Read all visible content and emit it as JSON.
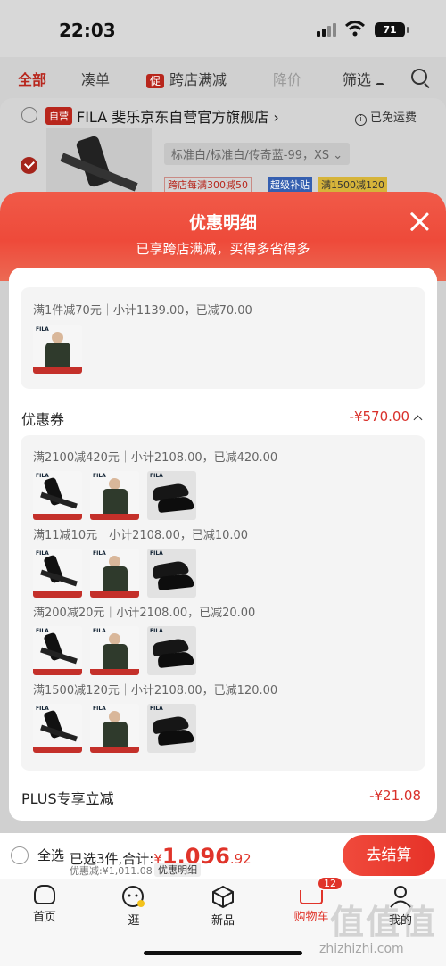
{
  "status_bar": {
    "time": "22:03",
    "battery": "71"
  },
  "background_page": {
    "tabs": {
      "all": "全部",
      "combo": "凑单",
      "promo_badge": "促",
      "cross_store": "跨店满减",
      "price_drop": "降价",
      "filter": "筛选"
    },
    "shop": {
      "self_badge": "自营",
      "name": "FILA 斐乐京东自营官方旗舰店 ›",
      "free_shipping": "已免运费"
    },
    "product": {
      "spec": "标准白/标准白/传奇蓝-99，XS ⌄",
      "tag_cross": "跨店每满300减50",
      "tag_subsidy": "超级补贴",
      "tag_coupon": "满1500减120"
    }
  },
  "sheet": {
    "title": "优惠明细",
    "subtitle": "已享跨店满减，买得多省得多",
    "promo_line": "满1件减70元｜小计1139.00，已减70.00",
    "coupon_section": {
      "label": "优惠券",
      "amount": "-¥570.00"
    },
    "coupon_lines": [
      "满2100减420元｜小计2108.00，已减420.00",
      "满11减10元｜小计2108.00，已减10.00",
      "满200减20元｜小计2108.00，已减20.00",
      "满1500减120元｜小计2108.00，已减120.00"
    ],
    "plus_section": {
      "label": "PLUS专享立减",
      "amount": "-¥21.08"
    },
    "thumb_brand": "FILA"
  },
  "checkout": {
    "select_all": "全选",
    "picked_prefix": "已选3件,合计:",
    "currency": "¥",
    "total_int": "1,096",
    "total_dec": ".92",
    "saved": "优惠减:¥1,011.08",
    "detail_button": "优惠明细",
    "pay_button": "去结算"
  },
  "tabbar": {
    "home": "首页",
    "browse": "逛",
    "new": "新品",
    "cart": "购物车",
    "cart_count": "12",
    "me": "我的"
  },
  "watermark": {
    "logo": "值值值",
    "url": "zhizhizhi.com"
  },
  "colors": {
    "accent": "#e0342a",
    "sheet_header": "#ee4a3a",
    "pay_button": "#e63228"
  }
}
